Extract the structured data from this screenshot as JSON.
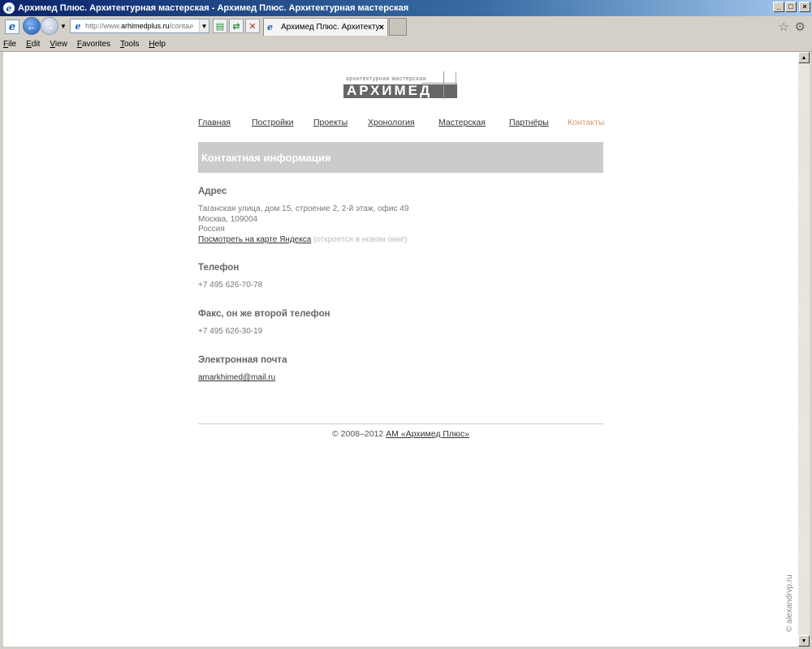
{
  "window": {
    "title": "Архимед Плюс. Архитектурная мастерская - Архимед Плюс. Архитектурная мастерская",
    "controls": {
      "minimize": "_",
      "maximize": "□",
      "close": "×"
    }
  },
  "navbar": {
    "address_prefix": "http://www.",
    "address_domain": "arhimedplus.ru",
    "address_suffix": "/conta",
    "tab_title": "Архимед Плюс. Архитекту...",
    "tab_close": "×"
  },
  "menu": [
    "File",
    "Edit",
    "View",
    "Favorites",
    "Tools",
    "Help"
  ],
  "logo": {
    "small": "архитектурная   мастерская",
    "big": "АРХИМЕД"
  },
  "nav": [
    {
      "label": "Главная",
      "active": false
    },
    {
      "label": "Постройки",
      "active": false
    },
    {
      "label": "Проекты",
      "active": false
    },
    {
      "label": "Хронология",
      "active": false
    },
    {
      "label": "Мастерская",
      "active": false
    },
    {
      "label": "Партнёры",
      "active": false
    },
    {
      "label": "Контакты",
      "active": true
    }
  ],
  "banner": "Контактная информация",
  "sections": {
    "address": {
      "heading": "Адрес",
      "line1": "Таганская улица, дом 15, строение 2, 2-й этаж, офис 49",
      "line2": "Москва, 109004",
      "line3": "Россия",
      "map_link": "Посмотреть на карте Яндекса",
      "map_note": "(откроется в новом окне)"
    },
    "phone": {
      "heading": "Телефон",
      "value": "+7 495 626-70-78"
    },
    "fax": {
      "heading": "Факс, он же второй телефон",
      "value": "+7 495 626-30-19"
    },
    "email": {
      "heading": "Электронная почта",
      "value": "amarkhimed@mail.ru"
    }
  },
  "footer": {
    "copyright": "© 2008–2012",
    "link": "АМ «Архимед Плюс»"
  },
  "watermark": "© alexandrvp.ru",
  "colors": {
    "active_nav": "#d79a6a",
    "banner_bg": "#cbcbcb",
    "logo_bg": "#666666"
  },
  "icons": [
    "ie-icon",
    "back-arrow-icon",
    "forward-arrow-icon",
    "search-icon",
    "refresh-icon",
    "stop-icon",
    "star-icon",
    "gear-icon"
  ]
}
